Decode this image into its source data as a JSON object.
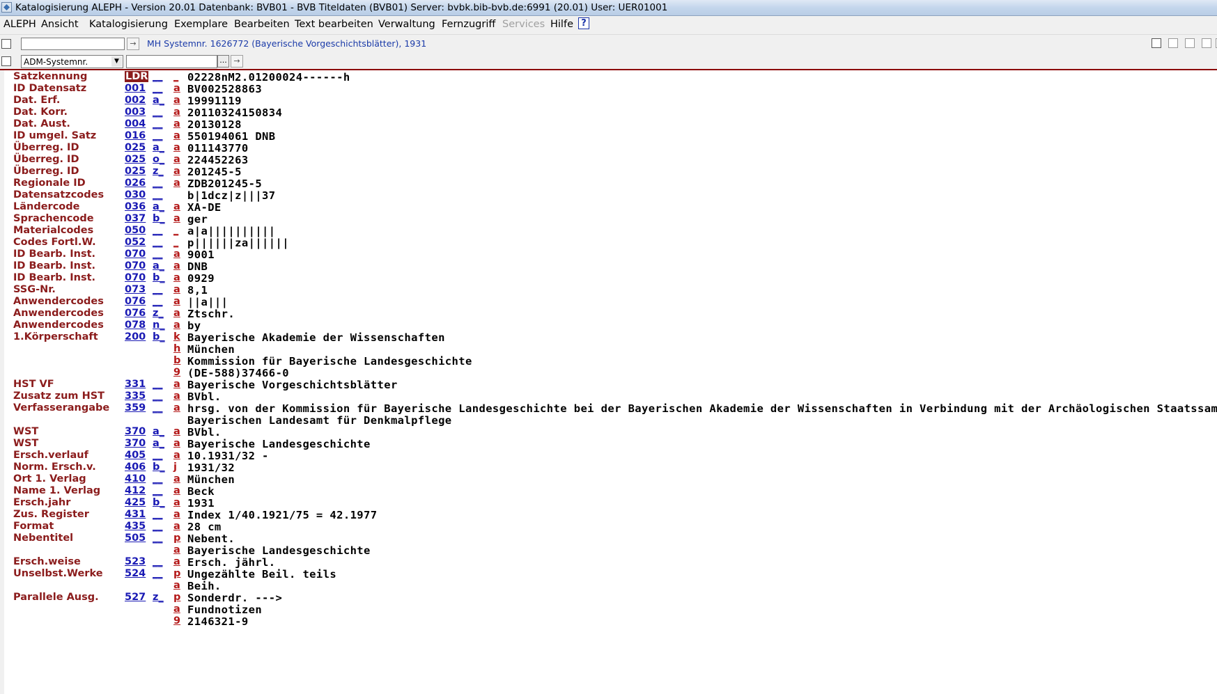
{
  "window": {
    "title": "Katalogisierung ALEPH - Version 20.01  Datenbank:  BVB01 - BVB Titeldaten (BVB01)  Server: bvbk.bib-bvb.de:6991 (20.01)  User:  UER01001"
  },
  "menu": [
    "ALEPH",
    "Ansicht",
    "Katalogisierung",
    "Exemplare",
    "Bearbeiten",
    "Text bearbeiten",
    "Verwaltung",
    "Fernzugriff",
    "Services",
    "Hilfe"
  ],
  "help_label": "?",
  "toolbar": {
    "search_value": "",
    "record_info": "MH Systemnr. 1626772 (Bayerische Vorgeschichtsblätter), 1931",
    "search_type": "ADM-Systemnr.",
    "search_value2": "",
    "dots": "..."
  },
  "rows": [
    {
      "label": "Satzkennung",
      "tag": "LDR",
      "ind": "__",
      "sub": "_",
      "value": "02228nM2.01200024------h"
    },
    {
      "label": "ID Datensatz",
      "tag": "001",
      "ind": "__",
      "sub": "a",
      "value": "BV002528863"
    },
    {
      "label": "Dat. Erf.",
      "tag": "002",
      "ind": "a_",
      "sub": "a",
      "value": "19991119"
    },
    {
      "label": "Dat. Korr.",
      "tag": "003",
      "ind": "__",
      "sub": "a",
      "value": "20110324150834"
    },
    {
      "label": "Dat. Aust.",
      "tag": "004",
      "ind": "__",
      "sub": "a",
      "value": "20130128"
    },
    {
      "label": "ID umgel. Satz",
      "tag": "016",
      "ind": "__",
      "sub": "a",
      "value": "550194061  DNB"
    },
    {
      "label": "Überreg. ID",
      "tag": "025",
      "ind": "a_",
      "sub": "a",
      "value": "011143770"
    },
    {
      "label": "Überreg. ID",
      "tag": "025",
      "ind": "o_",
      "sub": "a",
      "value": "224452263"
    },
    {
      "label": "Überreg. ID",
      "tag": "025",
      "ind": "z_",
      "sub": "a",
      "value": "201245-5"
    },
    {
      "label": "Regionale ID",
      "tag": "026",
      "ind": "__",
      "sub": "a",
      "value": "ZDB201245-5"
    },
    {
      "label": "Datensatzcodes",
      "tag": "030",
      "ind": "__",
      "sub": "",
      "value": "b|1dcz|z|||37"
    },
    {
      "label": "Ländercode",
      "tag": "036",
      "ind": "a_",
      "sub": "a",
      "value": "XA-DE"
    },
    {
      "label": "Sprachencode",
      "tag": "037",
      "ind": "b_",
      "sub": "a",
      "value": "ger"
    },
    {
      "label": "Materialcodes",
      "tag": "050",
      "ind": "__",
      "sub": "_",
      "value": "a|a||||||||||"
    },
    {
      "label": "Codes Fortl.W.",
      "tag": "052",
      "ind": "__",
      "sub": "_",
      "value": "p||||||za||||||"
    },
    {
      "label": "ID Bearb. Inst.",
      "tag": "070",
      "ind": "__",
      "sub": "a",
      "value": "9001"
    },
    {
      "label": "ID Bearb. Inst.",
      "tag": "070",
      "ind": "a_",
      "sub": "a",
      "value": "DNB"
    },
    {
      "label": "ID Bearb. Inst.",
      "tag": "070",
      "ind": "b_",
      "sub": "a",
      "value": "0929"
    },
    {
      "label": "SSG-Nr.",
      "tag": "073",
      "ind": "__",
      "sub": "a",
      "value": "8,1"
    },
    {
      "label": "Anwendercodes",
      "tag": "076",
      "ind": "__",
      "sub": "a",
      "value": "||a|||"
    },
    {
      "label": "Anwendercodes",
      "tag": "076",
      "ind": "z_",
      "sub": "a",
      "value": "Ztschr."
    },
    {
      "label": "Anwendercodes",
      "tag": "078",
      "ind": "n_",
      "sub": "a",
      "value": "by"
    },
    {
      "label": "1.Körperschaft",
      "tag": "200",
      "ind": "b_",
      "sub": "k",
      "value": "Bayerische Akademie der Wissenschaften"
    },
    {
      "label": "",
      "tag": "",
      "ind": "",
      "sub": "h",
      "value": "München"
    },
    {
      "label": "",
      "tag": "",
      "ind": "",
      "sub": "b",
      "value": "Kommission für Bayerische Landesgeschichte"
    },
    {
      "label": "",
      "tag": "",
      "ind": "",
      "sub": "9",
      "value": "(DE-588)37466-0"
    },
    {
      "label": "HST VF",
      "tag": "331",
      "ind": "__",
      "sub": "a",
      "value": "Bayerische Vorgeschichtsblätter"
    },
    {
      "label": "Zusatz zum HST",
      "tag": "335",
      "ind": "__",
      "sub": "a",
      "value": "BVbl."
    },
    {
      "label": "Verfasserangabe",
      "tag": "359",
      "ind": "__",
      "sub": "a",
      "value": "hrsg. von der Kommission für Bayerische Landesgeschichte bei der Bayerischen Akademie der Wissenschaften in Verbindung mit der Archäologischen Staatssammlung und dem"
    },
    {
      "label": "",
      "tag": "",
      "ind": "",
      "sub": "",
      "value": "Bayerischen Landesamt für Denkmalpflege"
    },
    {
      "label": "WST",
      "tag": "370",
      "ind": "a_",
      "sub": "a",
      "value": "BVbl."
    },
    {
      "label": "WST",
      "tag": "370",
      "ind": "a_",
      "sub": "a",
      "value": "Bayerische Landesgeschichte"
    },
    {
      "label": "Ersch.verlauf",
      "tag": "405",
      "ind": "__",
      "sub": "a",
      "value": "10.1931/32 -"
    },
    {
      "label": "Norm. Ersch.v.",
      "tag": "406",
      "ind": "b_",
      "sub": "j",
      "value": "1931/32"
    },
    {
      "label": "Ort 1. Verlag",
      "tag": "410",
      "ind": "__",
      "sub": "a",
      "value": "München"
    },
    {
      "label": "Name 1. Verlag",
      "tag": "412",
      "ind": "__",
      "sub": "a",
      "value": "Beck"
    },
    {
      "label": "Ersch.jahr",
      "tag": "425",
      "ind": "b_",
      "sub": "a",
      "value": "1931"
    },
    {
      "label": "Zus. Register",
      "tag": "431",
      "ind": "__",
      "sub": "a",
      "value": "Index 1/40.1921/75 = 42.1977"
    },
    {
      "label": "Format",
      "tag": "435",
      "ind": "__",
      "sub": "a",
      "value": "28 cm"
    },
    {
      "label": "Nebentitel",
      "tag": "505",
      "ind": "__",
      "sub": "p",
      "value": "Nebent."
    },
    {
      "label": "",
      "tag": "",
      "ind": "",
      "sub": "a",
      "value": "Bayerische Landesgeschichte"
    },
    {
      "label": "Ersch.weise",
      "tag": "523",
      "ind": "__",
      "sub": "a",
      "value": "Ersch. jährl."
    },
    {
      "label": "Unselbst.Werke",
      "tag": "524",
      "ind": "__",
      "sub": "p",
      "value": "Ungezählte Beil. teils"
    },
    {
      "label": "",
      "tag": "",
      "ind": "",
      "sub": "a",
      "value": "Beih."
    },
    {
      "label": "Parallele Ausg.",
      "tag": "527",
      "ind": "z_",
      "sub": "p",
      "value": "Sonderdr. --->"
    },
    {
      "label": "",
      "tag": "",
      "ind": "",
      "sub": "a",
      "value": "Fundnotizen"
    },
    {
      "label": "",
      "tag": "",
      "ind": "",
      "sub": "9",
      "value": "2146321-9"
    }
  ]
}
